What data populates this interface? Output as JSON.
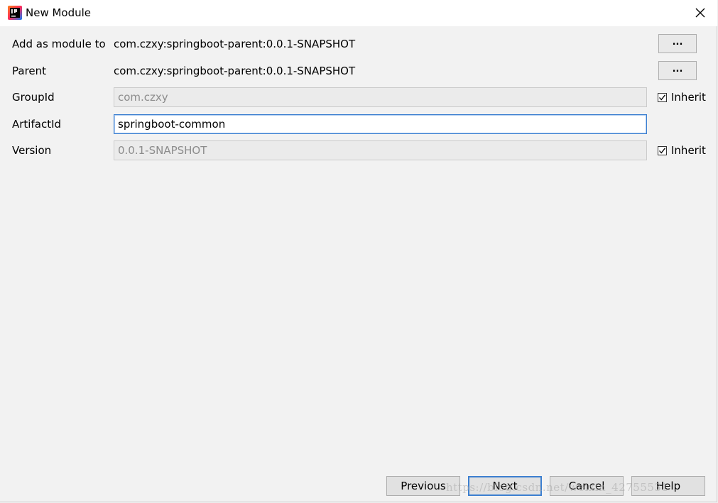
{
  "window": {
    "title": "New Module",
    "icon": "intellij-idea-icon",
    "close_icon": "close-icon"
  },
  "form": {
    "add_as_module": {
      "label": "Add as module to",
      "value": "com.czxy:springboot-parent:0.0.1-SNAPSHOT",
      "button_label": "..."
    },
    "parent": {
      "label": "Parent",
      "value": "com.czxy:springboot-parent:0.0.1-SNAPSHOT",
      "button_label": "..."
    },
    "group_id": {
      "label": "GroupId",
      "value": "com.czxy",
      "inherit_label": "Inherit",
      "inherit_checked": true
    },
    "artifact_id": {
      "label": "ArtifactId",
      "value": "springboot-common"
    },
    "version": {
      "label": "Version",
      "value": "0.0.1-SNAPSHOT",
      "inherit_label": "Inherit",
      "inherit_checked": true
    }
  },
  "buttons": {
    "previous": "Previous",
    "next": "Next",
    "cancel": "Cancel",
    "help": "Help"
  },
  "watermark": "https://blog.csdn.net/weixin_42755531",
  "colors": {
    "accent": "#3c7fd0",
    "background": "#f2f2f2"
  }
}
